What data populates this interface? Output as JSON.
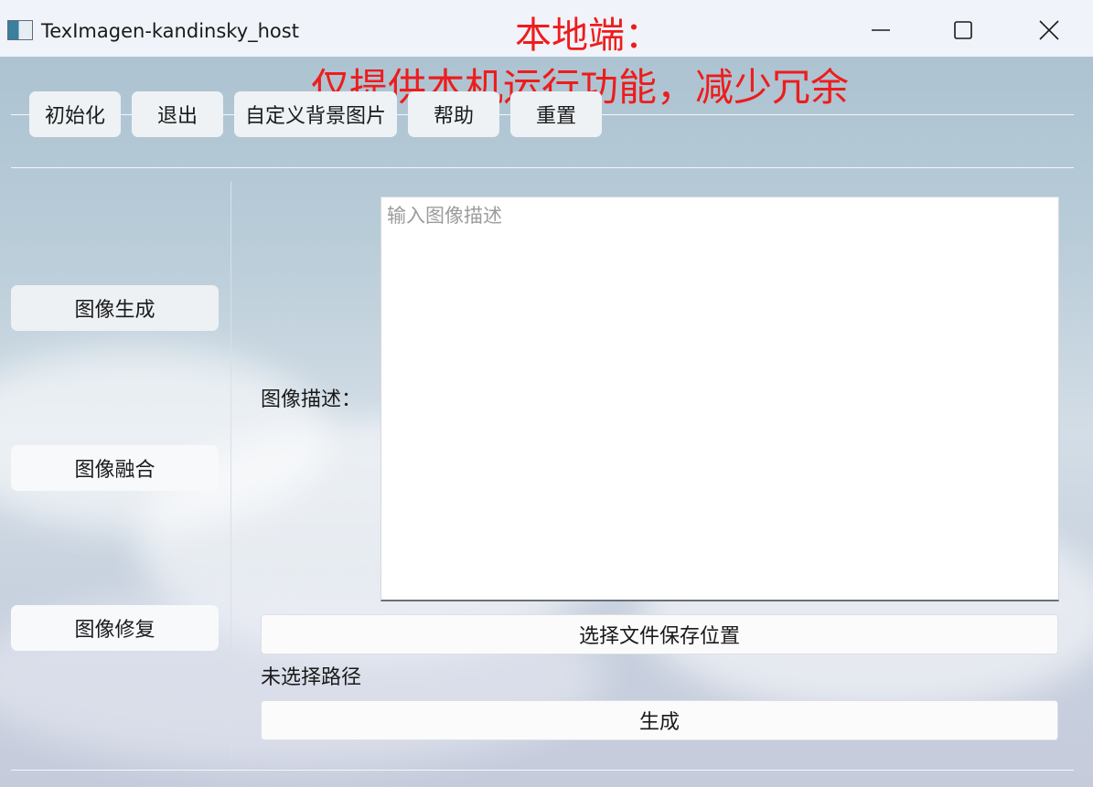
{
  "window": {
    "title": "TexImagen-kandinsky_host"
  },
  "annotation": {
    "line1": "本地端：",
    "line2": "仅提供本机运行功能，减少冗余"
  },
  "toolbar": {
    "init_label": "初始化",
    "exit_label": "退出",
    "custom_bg_label": "自定义背景图片",
    "help_label": "帮助",
    "reset_label": "重置"
  },
  "sidebar": {
    "items": [
      {
        "label": "图像生成",
        "active": true
      },
      {
        "label": "图像融合",
        "active": false
      },
      {
        "label": "图像修复",
        "active": false
      }
    ]
  },
  "main": {
    "desc_label": "图像描述：",
    "desc_placeholder": "输入图像描述",
    "desc_value": "",
    "save_location_label": "选择文件保存位置",
    "path_status": "未选择路径",
    "generate_label": "生成"
  },
  "colors": {
    "annotation": "#ee1c1c",
    "titlebar_bg": "#f0f3f9"
  },
  "icons": {
    "app": "app-icon",
    "minimize": "minimize-icon",
    "maximize": "maximize-icon",
    "close": "close-icon"
  }
}
